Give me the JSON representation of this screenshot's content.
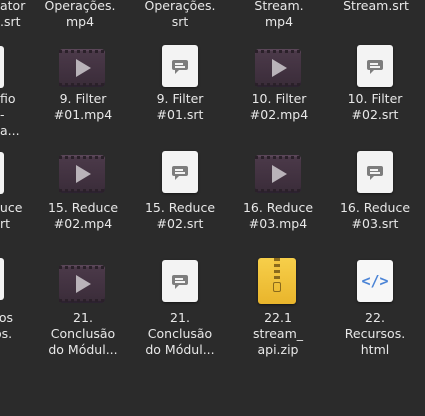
{
  "colors": {
    "background": "#2b2b2b",
    "video": "#3f3040",
    "zip": "#f2c33b",
    "html_accent": "#4b84d6"
  },
  "icons": {
    "video": "video-file-icon",
    "subtitle": "subtitle-file-icon",
    "zip": "zip-archive-icon",
    "html": "html-file-icon"
  },
  "row0": {
    "c0": "ator",
    "c0b": ".srt",
    "c1a": "Operações.",
    "c1b": "mp4",
    "c2a": "Operações.",
    "c2b": "srt",
    "c3a": "Stream.",
    "c3b": "mp4",
    "c4a": "Stream.srt"
  },
  "row1": {
    "c0a": "fio",
    "c0b": "-",
    "c0c": "a...",
    "c1a": "9. Filter",
    "c1b": "#01.mp4",
    "c2a": "9. Filter",
    "c2b": "#01.srt",
    "c3a": "10. Filter",
    "c3b": "#02.mp4",
    "c4a": "10. Filter",
    "c4b": "#02.srt"
  },
  "row2": {
    "c0a": "duce",
    "c0b": "rt",
    "c1a": "15. Reduce",
    "c1b": "#02.mp4",
    "c2a": "15. Reduce",
    "c2b": "#02.srt",
    "c3a": "16. Reduce",
    "c3b": "#03.mp4",
    "c4a": "16. Reduce",
    "c4b": "#03.srt"
  },
  "row3": {
    "c0a": "ros",
    "c0b": "os.",
    "c1a": "21.",
    "c1b": "Conclusão",
    "c1c": "do Módul...",
    "c2a": "21.",
    "c2b": "Conclusão",
    "c2c": "do Módul...",
    "c3a": "22.1",
    "c3b": "stream_",
    "c3c": "api.zip",
    "c4a": "22.",
    "c4b": "Recursos.",
    "c4c": "html",
    "html_glyph": "</>"
  }
}
